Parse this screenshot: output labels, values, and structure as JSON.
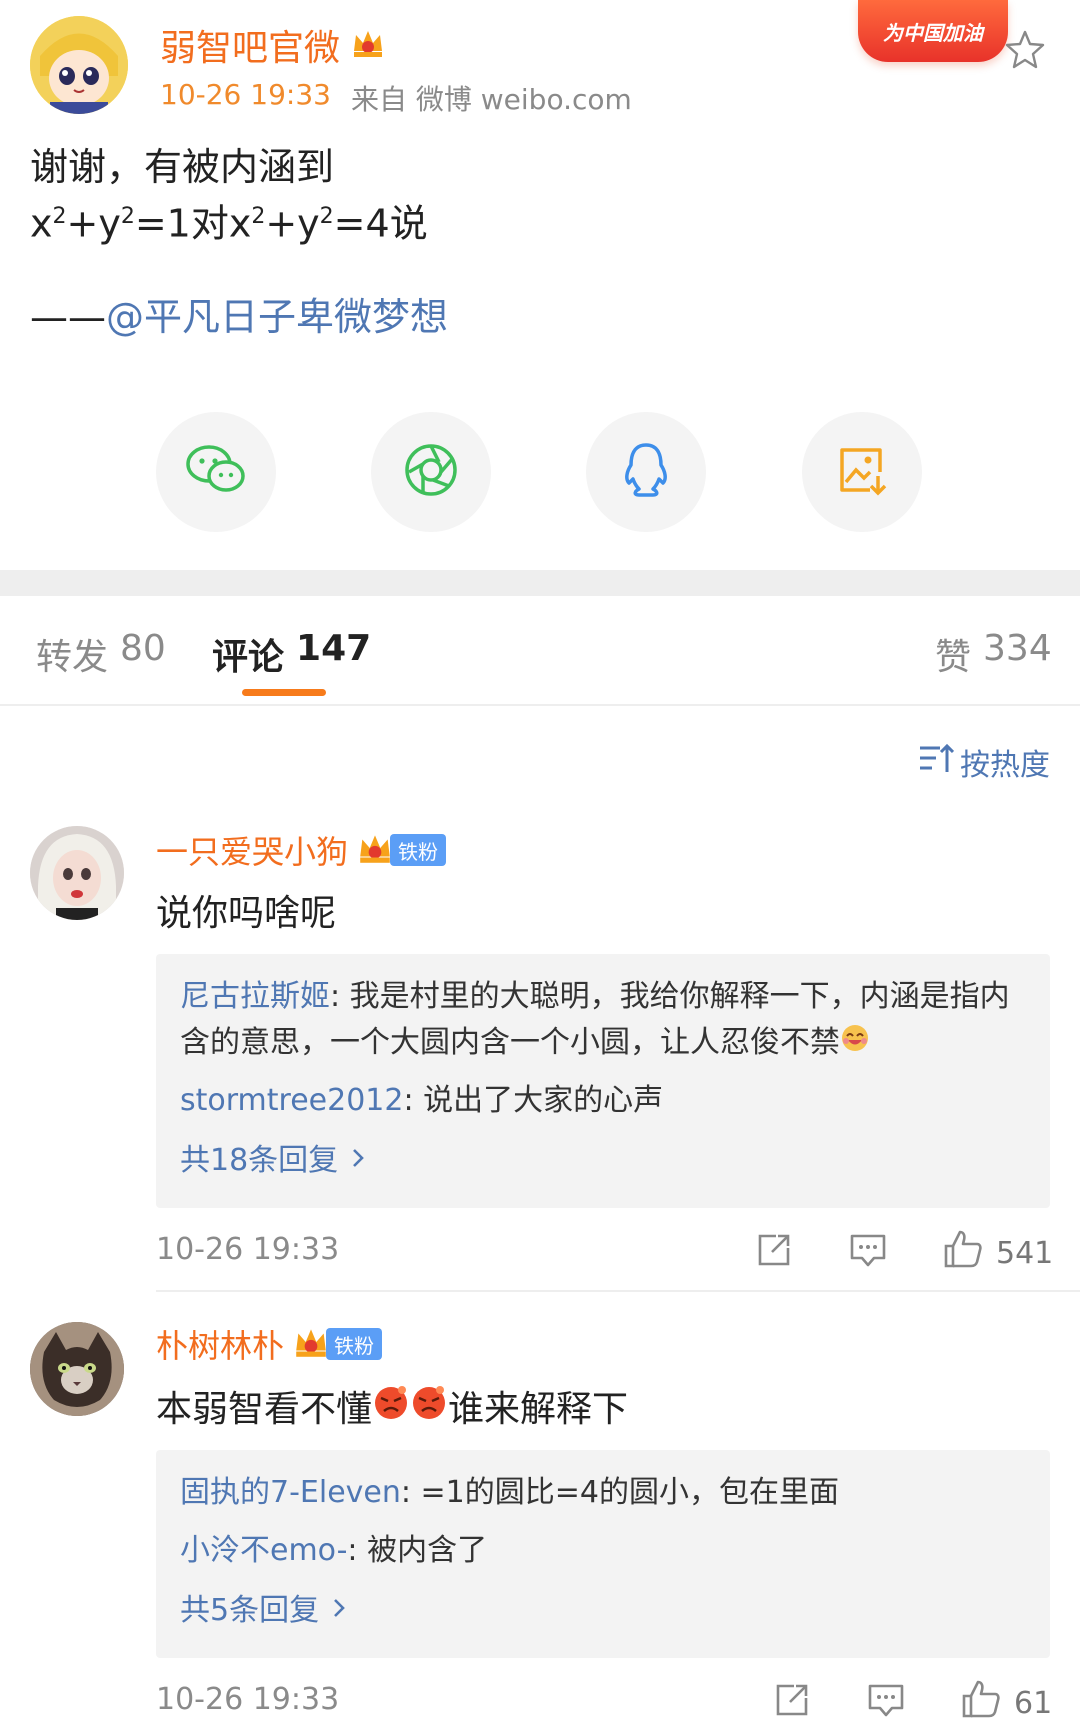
{
  "post": {
    "author": "弱智吧官微",
    "time": "10-26 19:33",
    "source_prefix": "来自",
    "source": "微博 weibo.com",
    "promo": "为中国加油",
    "line1": "谢谢，有被内涵到",
    "line2_part1": "x",
    "line2_sup1": "2",
    "line2_part2": "+y",
    "line2_sup2": "2",
    "line2_part3": "=1对x",
    "line2_sup3": "2",
    "line2_part4": "+y",
    "line2_sup4": "2",
    "line2_part5": "=4说",
    "dash": "——",
    "mention": "@平凡日子卑微梦想"
  },
  "share": {
    "icons": [
      "wechat-icon",
      "moments-icon",
      "qq-icon",
      "save-image-icon"
    ],
    "colors": {
      "green": "#3fbf5a",
      "blue": "#3d8eea",
      "orange": "#f4a623"
    }
  },
  "tabs": {
    "repost_label": "转发",
    "repost_count": "80",
    "comment_label": "评论",
    "comment_count": "147",
    "like_label": "赞",
    "like_count": "334",
    "active_color": "#f77b1b"
  },
  "sort": {
    "label": "按热度"
  },
  "comments": [
    {
      "user": "一只爱哭小狗",
      "badge": "铁粉",
      "text": "说你吗啥呢",
      "replies": [
        {
          "user": "尼古拉斯姬",
          "text": ": 我是村里的大聪明，我给你解释一下，内涵是指内含的意思，一个大圆内含一个小圆，让人忍俊不禁"
        },
        {
          "user": "stormtree2012",
          "text": ": 说出了大家的心声"
        }
      ],
      "more": "共18条回复",
      "time": "10-26 19:33",
      "likes": "541"
    },
    {
      "user": "朴树林朴",
      "badge": "铁粉",
      "text_part1": "本弱智看不懂",
      "text_part2": "谁来解释下",
      "replies": [
        {
          "user": "固执的7-Eleven",
          "text": ": =1的圆比=4的圆小，包在里面"
        },
        {
          "user": "小泠不emo-",
          "text": ": 被内含了"
        }
      ],
      "more": "共5条回复",
      "time": "10-26 19:33",
      "likes": "61"
    }
  ]
}
